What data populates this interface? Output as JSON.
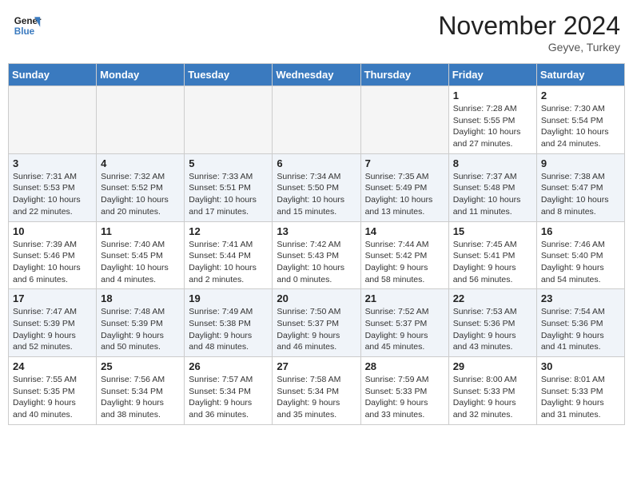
{
  "header": {
    "logo_line1": "General",
    "logo_line2": "Blue",
    "month": "November 2024",
    "location": "Geyve, Turkey"
  },
  "days_of_week": [
    "Sunday",
    "Monday",
    "Tuesday",
    "Wednesday",
    "Thursday",
    "Friday",
    "Saturday"
  ],
  "weeks": [
    [
      {
        "day": "",
        "info": ""
      },
      {
        "day": "",
        "info": ""
      },
      {
        "day": "",
        "info": ""
      },
      {
        "day": "",
        "info": ""
      },
      {
        "day": "",
        "info": ""
      },
      {
        "day": "1",
        "info": "Sunrise: 7:28 AM\nSunset: 5:55 PM\nDaylight: 10 hours and 27 minutes."
      },
      {
        "day": "2",
        "info": "Sunrise: 7:30 AM\nSunset: 5:54 PM\nDaylight: 10 hours and 24 minutes."
      }
    ],
    [
      {
        "day": "3",
        "info": "Sunrise: 7:31 AM\nSunset: 5:53 PM\nDaylight: 10 hours and 22 minutes."
      },
      {
        "day": "4",
        "info": "Sunrise: 7:32 AM\nSunset: 5:52 PM\nDaylight: 10 hours and 20 minutes."
      },
      {
        "day": "5",
        "info": "Sunrise: 7:33 AM\nSunset: 5:51 PM\nDaylight: 10 hours and 17 minutes."
      },
      {
        "day": "6",
        "info": "Sunrise: 7:34 AM\nSunset: 5:50 PM\nDaylight: 10 hours and 15 minutes."
      },
      {
        "day": "7",
        "info": "Sunrise: 7:35 AM\nSunset: 5:49 PM\nDaylight: 10 hours and 13 minutes."
      },
      {
        "day": "8",
        "info": "Sunrise: 7:37 AM\nSunset: 5:48 PM\nDaylight: 10 hours and 11 minutes."
      },
      {
        "day": "9",
        "info": "Sunrise: 7:38 AM\nSunset: 5:47 PM\nDaylight: 10 hours and 8 minutes."
      }
    ],
    [
      {
        "day": "10",
        "info": "Sunrise: 7:39 AM\nSunset: 5:46 PM\nDaylight: 10 hours and 6 minutes."
      },
      {
        "day": "11",
        "info": "Sunrise: 7:40 AM\nSunset: 5:45 PM\nDaylight: 10 hours and 4 minutes."
      },
      {
        "day": "12",
        "info": "Sunrise: 7:41 AM\nSunset: 5:44 PM\nDaylight: 10 hours and 2 minutes."
      },
      {
        "day": "13",
        "info": "Sunrise: 7:42 AM\nSunset: 5:43 PM\nDaylight: 10 hours and 0 minutes."
      },
      {
        "day": "14",
        "info": "Sunrise: 7:44 AM\nSunset: 5:42 PM\nDaylight: 9 hours and 58 minutes."
      },
      {
        "day": "15",
        "info": "Sunrise: 7:45 AM\nSunset: 5:41 PM\nDaylight: 9 hours and 56 minutes."
      },
      {
        "day": "16",
        "info": "Sunrise: 7:46 AM\nSunset: 5:40 PM\nDaylight: 9 hours and 54 minutes."
      }
    ],
    [
      {
        "day": "17",
        "info": "Sunrise: 7:47 AM\nSunset: 5:39 PM\nDaylight: 9 hours and 52 minutes."
      },
      {
        "day": "18",
        "info": "Sunrise: 7:48 AM\nSunset: 5:39 PM\nDaylight: 9 hours and 50 minutes."
      },
      {
        "day": "19",
        "info": "Sunrise: 7:49 AM\nSunset: 5:38 PM\nDaylight: 9 hours and 48 minutes."
      },
      {
        "day": "20",
        "info": "Sunrise: 7:50 AM\nSunset: 5:37 PM\nDaylight: 9 hours and 46 minutes."
      },
      {
        "day": "21",
        "info": "Sunrise: 7:52 AM\nSunset: 5:37 PM\nDaylight: 9 hours and 45 minutes."
      },
      {
        "day": "22",
        "info": "Sunrise: 7:53 AM\nSunset: 5:36 PM\nDaylight: 9 hours and 43 minutes."
      },
      {
        "day": "23",
        "info": "Sunrise: 7:54 AM\nSunset: 5:36 PM\nDaylight: 9 hours and 41 minutes."
      }
    ],
    [
      {
        "day": "24",
        "info": "Sunrise: 7:55 AM\nSunset: 5:35 PM\nDaylight: 9 hours and 40 minutes."
      },
      {
        "day": "25",
        "info": "Sunrise: 7:56 AM\nSunset: 5:34 PM\nDaylight: 9 hours and 38 minutes."
      },
      {
        "day": "26",
        "info": "Sunrise: 7:57 AM\nSunset: 5:34 PM\nDaylight: 9 hours and 36 minutes."
      },
      {
        "day": "27",
        "info": "Sunrise: 7:58 AM\nSunset: 5:34 PM\nDaylight: 9 hours and 35 minutes."
      },
      {
        "day": "28",
        "info": "Sunrise: 7:59 AM\nSunset: 5:33 PM\nDaylight: 9 hours and 33 minutes."
      },
      {
        "day": "29",
        "info": "Sunrise: 8:00 AM\nSunset: 5:33 PM\nDaylight: 9 hours and 32 minutes."
      },
      {
        "day": "30",
        "info": "Sunrise: 8:01 AM\nSunset: 5:33 PM\nDaylight: 9 hours and 31 minutes."
      }
    ]
  ]
}
